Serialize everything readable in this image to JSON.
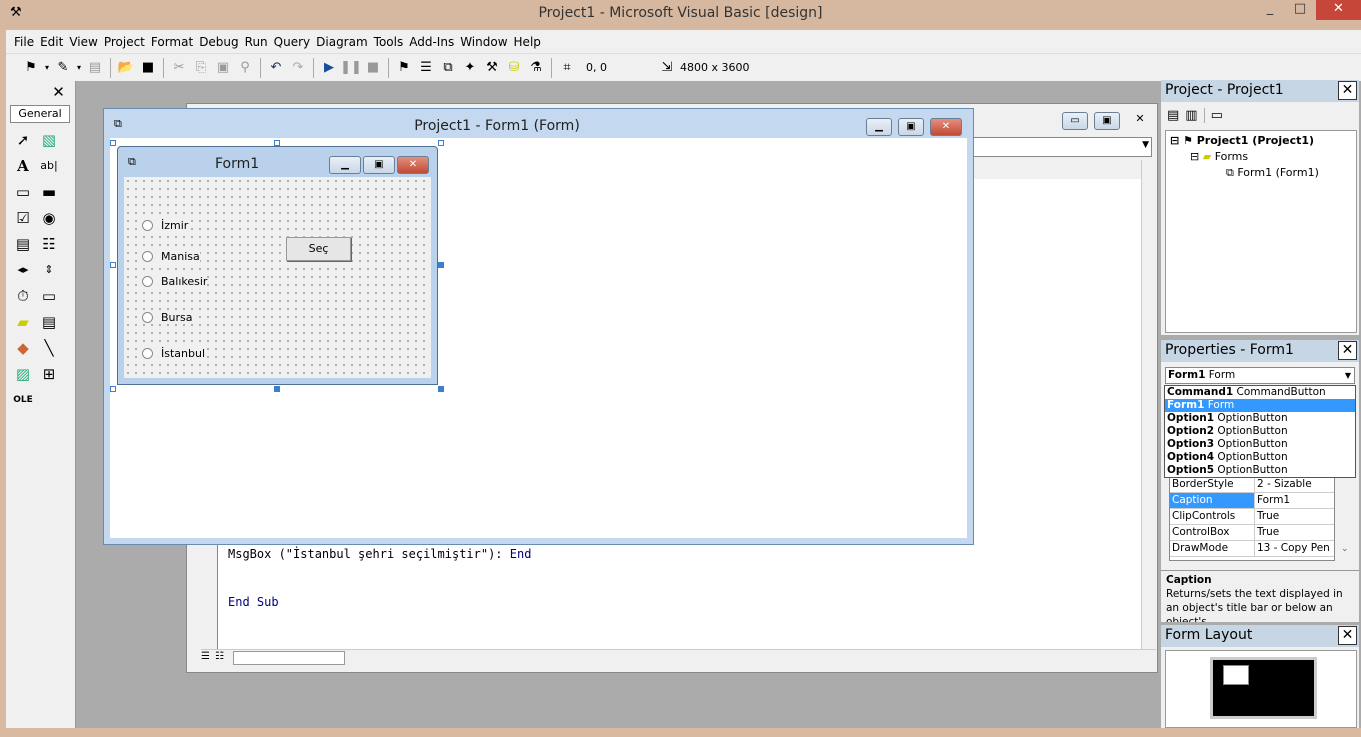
{
  "app": {
    "title": "Project1 - Microsoft Visual Basic [design]",
    "window_buttons": [
      "_",
      "□",
      "✕"
    ]
  },
  "menu": [
    "File",
    "Edit",
    "View",
    "Project",
    "Format",
    "Debug",
    "Run",
    "Query",
    "Diagram",
    "Tools",
    "Add-Ins",
    "Window",
    "Help"
  ],
  "toolbar": {
    "position": "0, 0",
    "size": "4800 x 3600"
  },
  "toolbox": {
    "tab": "General",
    "tools": [
      "pointer",
      "picture-box",
      "label",
      "text-box",
      "frame",
      "command-button",
      "check-box",
      "option-button",
      "combo-box",
      "list-box",
      "hscroll",
      "vscroll",
      "timer",
      "drive-list",
      "dir-list",
      "file-list",
      "shape",
      "line",
      "image",
      "data",
      "ole"
    ]
  },
  "code": {
    "lines": [
      {
        "text": "MsgBox (\"İstanbul şehri seçilmiştir\"): ",
        "kw": "End"
      },
      {
        "text": "",
        "kw": ""
      },
      {
        "text": "",
        "kw": ""
      },
      {
        "text": "",
        "kw": "End Sub"
      }
    ]
  },
  "designer": {
    "title": "Project1 - Form1 (Form)"
  },
  "form1": {
    "title": "Form1",
    "options": [
      "İzmir",
      "Manisa",
      "Balıkesir",
      "Bursa",
      "İstanbul"
    ],
    "button": "Seç"
  },
  "project_pane": {
    "title": "Project - Project1",
    "tree": {
      "root": "Project1 (Project1)",
      "folder": "Forms",
      "item": "Form1 (Form1)"
    }
  },
  "properties_pane": {
    "title": "Properties - Form1",
    "selected": {
      "name": "Form1",
      "type": "Form"
    },
    "dropdown": [
      {
        "name": "Command1",
        "type": "CommandButton"
      },
      {
        "name": "Form1",
        "type": "Form"
      },
      {
        "name": "Option1",
        "type": "OptionButton"
      },
      {
        "name": "Option2",
        "type": "OptionButton"
      },
      {
        "name": "Option3",
        "type": "OptionButton"
      },
      {
        "name": "Option4",
        "type": "OptionButton"
      },
      {
        "name": "Option5",
        "type": "OptionButton"
      }
    ],
    "rows": [
      {
        "k": "BorderStyle",
        "v": "2 - Sizable"
      },
      {
        "k": "Caption",
        "v": "Form1"
      },
      {
        "k": "ClipControls",
        "v": "True"
      },
      {
        "k": "ControlBox",
        "v": "True"
      },
      {
        "k": "DrawMode",
        "v": "13 - Copy Pen"
      }
    ],
    "desc_title": "Caption",
    "desc_text": "Returns/sets the text displayed in an object's title bar or below an object's"
  },
  "layout_pane": {
    "title": "Form Layout"
  }
}
